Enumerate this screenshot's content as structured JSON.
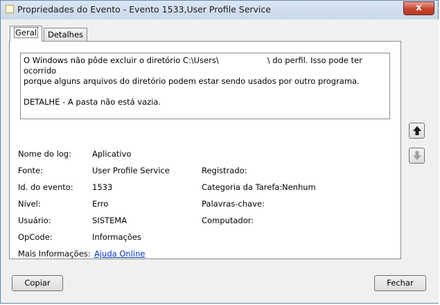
{
  "window": {
    "title": "Propriedades do Evento - Evento 1533,User Profile Service",
    "close_glyph": "x"
  },
  "tabs": [
    {
      "label": "Geral",
      "active": true
    },
    {
      "label": "Detalhes",
      "active": false
    }
  ],
  "description": {
    "line1_start": "O Windows não pôde excluir o diretório C:\\Users\\",
    "line1_end": "\\ do perfil. Isso pode ter ocorrido",
    "line2": "porque alguns arquivos do diretório podem estar sendo usados por outro programa.",
    "line3": "DETALHE - A pasta não está vazia."
  },
  "fields": {
    "log_name": {
      "label": "Nome do log:",
      "value": "Aplicativo"
    },
    "source": {
      "label": "Fonte:",
      "value": "User Profile Service"
    },
    "event_id": {
      "label": "Id. do evento:",
      "value": "1533"
    },
    "level": {
      "label": "Nível:",
      "value": "Erro"
    },
    "user": {
      "label": "Usuário:",
      "value": "SISTEMA"
    },
    "opcode": {
      "label": "OpCode:",
      "value": "Informações"
    },
    "more_info": {
      "label": "Mais Informações:",
      "link": "Ajuda Online"
    },
    "logged": {
      "label": "Registrado:",
      "value": ""
    },
    "task_category": {
      "label": "Categoria da Tarefa:",
      "value": "Nenhum"
    },
    "keywords": {
      "label": "Palavras-chave:",
      "value": ""
    },
    "computer": {
      "label": "Computador:",
      "value": ""
    }
  },
  "buttons": {
    "copy": "Copiar",
    "close": "Fechar"
  },
  "nav_icons": {
    "up": "arrow-up-icon",
    "down": "arrow-down-icon"
  }
}
